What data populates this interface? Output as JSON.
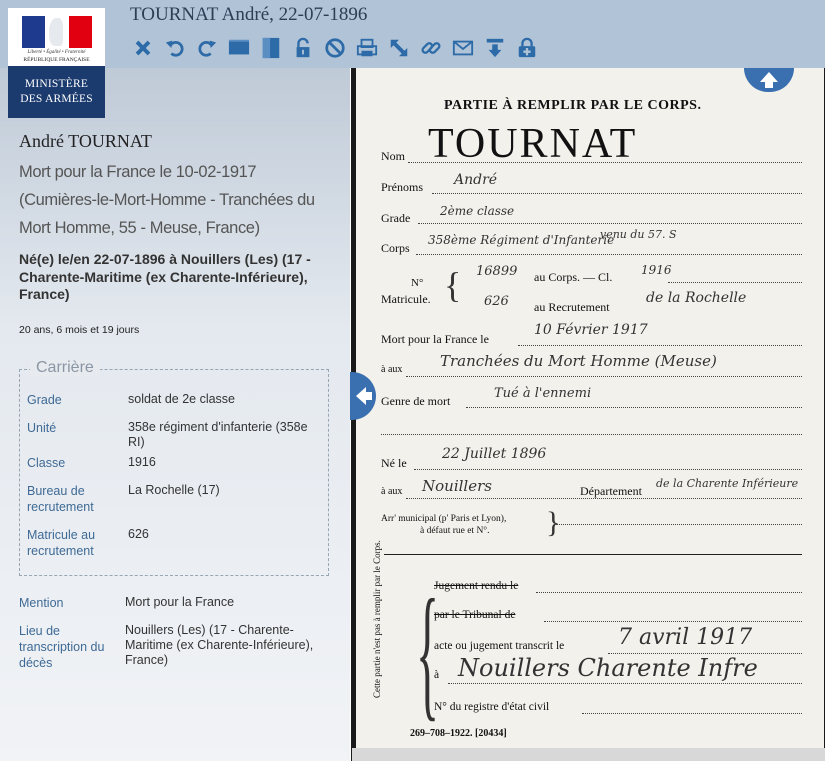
{
  "header": {
    "title": "TOURNAT André, 22-07-1896"
  },
  "toolbar": {
    "icons": [
      "close-icon",
      "rotate-left-icon",
      "rotate-right-icon",
      "horizontal-view-icon",
      "vertical-view-icon",
      "lock-icon",
      "forbidden-icon",
      "print-icon",
      "fullscreen-icon",
      "link-icon",
      "email-icon",
      "download-icon",
      "add-icon"
    ]
  },
  "logo": {
    "motto": "Liberté • Égalité • Fraternité",
    "republic": "RÉPUBLIQUE FRANÇAISE",
    "ministry_line1": "MINISTÈRE",
    "ministry_line2": "DES ARMÉES"
  },
  "person": {
    "name": "André TOURNAT",
    "death": "Mort pour la France le 10-02-1917 (Cumières-le-Mort-Homme - Tranchées du Mort Homme, 55 - Meuse, France)",
    "birth": "Né(e) le/en 22-07-1896 à Nouillers (Les) (17 - Charente-Maritime (ex Charente-Inférieure), France)",
    "age": "20 ans, 6 mois et 19 jours"
  },
  "career": {
    "legend": "Carrière",
    "rows": [
      {
        "label": "Grade",
        "value": "soldat de 2e classe"
      },
      {
        "label": "Unité",
        "value": "358e régiment d'infanterie (358e RI)"
      },
      {
        "label": "Classe",
        "value": "1916"
      },
      {
        "label": "Bureau de recrutement",
        "value": "La Rochelle (17)"
      },
      {
        "label": "Matricule au recrutement",
        "value": "626"
      }
    ]
  },
  "extra": {
    "rows": [
      {
        "label": "Mention",
        "value": "Mort pour la France"
      },
      {
        "label": "Lieu de transcription du décès",
        "value": "Nouillers (Les) (17 - Charente-Maritime (ex Charente-Inférieure), France)"
      }
    ]
  },
  "document": {
    "header": "PARTIE À REMPLIR PAR LE CORPS.",
    "nom_label": "Nom",
    "nom_value": "TOURNAT",
    "prenoms_label": "Prénoms",
    "prenoms_value": "André",
    "grade_label": "Grade",
    "grade_value": "2ème classe",
    "corps_label": "Corps",
    "corps_value": "358ème Régiment d'Infanterie",
    "corps_note": "venu du 57. S",
    "no_label": "N°",
    "matricule_label": "Matricule.",
    "corps_no_value": "16899",
    "au_corps": "au Corps. — Cl.",
    "classe_value": "1916",
    "recrut_no_value": "626",
    "au_recrutement": "au Recrutement",
    "recrut_value": "de la Rochelle",
    "mort_label": "Mort pour la France le",
    "mort_date": "10 Février 1917",
    "a_prefix": "à aux",
    "mort_lieu": "Tranchées du Mort Homme (Meuse)",
    "genre_label": "Genre de mort",
    "genre_value": "Tué à l'ennemi",
    "ne_label": "Né le",
    "ne_date": "22 Juillet 1896",
    "ne_prefix": "à aux",
    "ne_lieu": "Nouillers",
    "departement_label": "Département",
    "departement_value": "de la Charente Inférieure",
    "arr_label": "Arr' municipal (p' Paris et Lyon),",
    "arr_label2": "à défaut rue et N°.",
    "side_label": "Cette partie n'est pas à remplir par le Corps.",
    "jugement_label": "Jugement rendu le",
    "tribunal_label": "par le Tribunal de",
    "acte_label": "acte ou jugement transcrit le",
    "acte_date": "7 avril 1917",
    "a_label": "à",
    "acte_lieu": "Nouillers Charente Infre",
    "registre_label": "N° du registre d'état civil",
    "footer": "269–708–1922.  [20434]"
  }
}
